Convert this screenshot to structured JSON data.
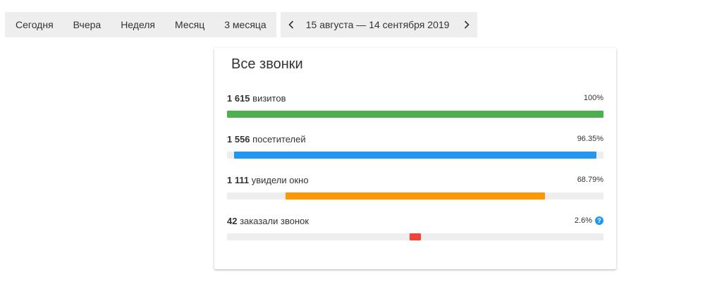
{
  "toolbar": {
    "periods": [
      "Сегодня",
      "Вчера",
      "Неделя",
      "Месяц",
      "3 месяца"
    ],
    "range_label": "15 августа — 14 сентября 2019"
  },
  "card": {
    "title": "Все звонки",
    "metrics": [
      {
        "count": "1 615",
        "label": "визитов",
        "pct": "100%",
        "fraction": 1.0,
        "color": "#4caf50"
      },
      {
        "count": "1 556",
        "label": "посетителей",
        "pct": "96.35%",
        "fraction": 0.9635,
        "color": "#2196f3"
      },
      {
        "count": "1 111",
        "label": "увидели окно",
        "pct": "68.79%",
        "fraction": 0.6879,
        "color": "#ff9800"
      },
      {
        "count": "42",
        "label": "заказали звонок",
        "pct": "2.6%",
        "fraction": 0.026,
        "color": "#f44336",
        "has_help": true
      }
    ]
  }
}
